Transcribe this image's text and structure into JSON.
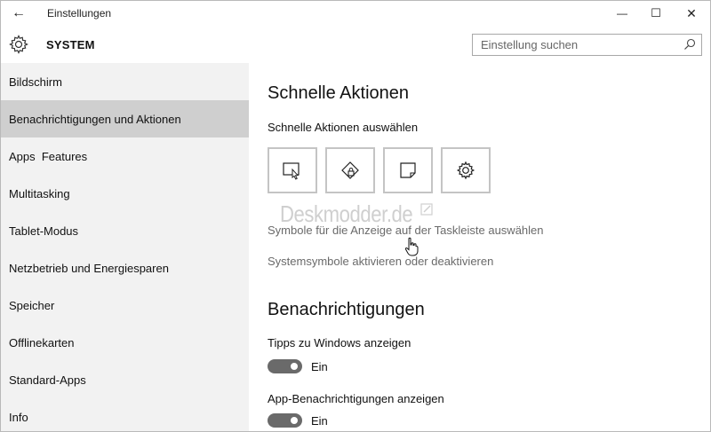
{
  "window": {
    "title": "Einstellungen",
    "back_glyph": "←",
    "minimize_glyph": "—",
    "maximize_glyph": "☐",
    "close_glyph": "✕"
  },
  "header": {
    "title": "SYSTEM",
    "icon": "gear-icon",
    "search": {
      "placeholder": "Einstellung suchen",
      "value": "",
      "icon": "search-icon"
    }
  },
  "sidebar": {
    "items": [
      {
        "label": "Bildschirm",
        "active": false
      },
      {
        "label": "Benachrichtigungen und Aktionen",
        "active": true
      },
      {
        "label": "Apps  Features",
        "active": false
      },
      {
        "label": "Multitasking",
        "active": false
      },
      {
        "label": "Tablet-Modus",
        "active": false
      },
      {
        "label": "Netzbetrieb und Energiesparen",
        "active": false
      },
      {
        "label": "Speicher",
        "active": false
      },
      {
        "label": "Offlinekarten",
        "active": false
      },
      {
        "label": "Standard-Apps",
        "active": false
      },
      {
        "label": "Info",
        "active": false
      }
    ]
  },
  "main": {
    "quick_actions": {
      "heading": "Schnelle Aktionen",
      "subtitle": "Schnelle Aktionen auswählen",
      "tiles": [
        {
          "icon": "tablet-mode-icon"
        },
        {
          "icon": "network-icon"
        },
        {
          "icon": "note-icon"
        },
        {
          "icon": "settings-gear-icon"
        }
      ],
      "links": [
        "Symbole für die Anzeige auf der Taskleiste auswählen",
        "Systemsymbole aktivieren oder deaktivieren"
      ],
      "watermark": "Deskmodder.de"
    },
    "notifications": {
      "heading": "Benachrichtigungen",
      "settings": [
        {
          "label": "Tipps zu Windows anzeigen",
          "state": "Ein",
          "on": true
        },
        {
          "label": "App-Benachrichtigungen anzeigen",
          "state": "Ein",
          "on": true
        }
      ]
    }
  },
  "colors": {
    "sidebar_bg": "#f2f2f2",
    "sidebar_active": "#cfcfcf",
    "toggle_on": "#6a6a6a",
    "link": "#6a6a6a",
    "tile_border": "#c4c4c4"
  }
}
